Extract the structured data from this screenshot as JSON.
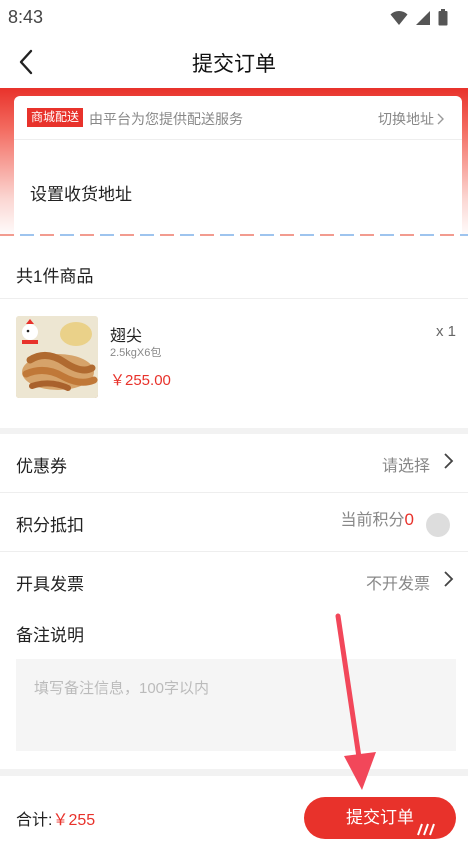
{
  "status_bar": {
    "time": "8:43",
    "icons": [
      "wifi-icon",
      "signal-icon",
      "battery-icon"
    ]
  },
  "header": {
    "title": "提交订单",
    "back_icon": "chevron-left-icon"
  },
  "address": {
    "tag": "商城配送",
    "hint": "由平台为您提供配送服务",
    "switch_label": "切换地址",
    "set_label": "设置收货地址"
  },
  "goods": {
    "count_label": "共1件商品",
    "items": [
      {
        "name": "翅尖",
        "spec": "2.5kgX6包",
        "price": "￥255.00",
        "qty": "x 1"
      }
    ]
  },
  "options": {
    "coupon": {
      "label": "优惠券",
      "value": "请选择"
    },
    "points": {
      "label": "积分抵扣",
      "value_prefix": "当前积分",
      "value": "0"
    },
    "invoice": {
      "label": "开具发票",
      "value": "不开发票"
    }
  },
  "remark": {
    "title": "备注说明",
    "placeholder": "填写备注信息，100字以内"
  },
  "footer": {
    "total_label": "合计:",
    "total_amount": "￥255",
    "submit_label": "提交订单"
  },
  "colors": {
    "accent": "#e8322b",
    "muted": "#888888"
  }
}
